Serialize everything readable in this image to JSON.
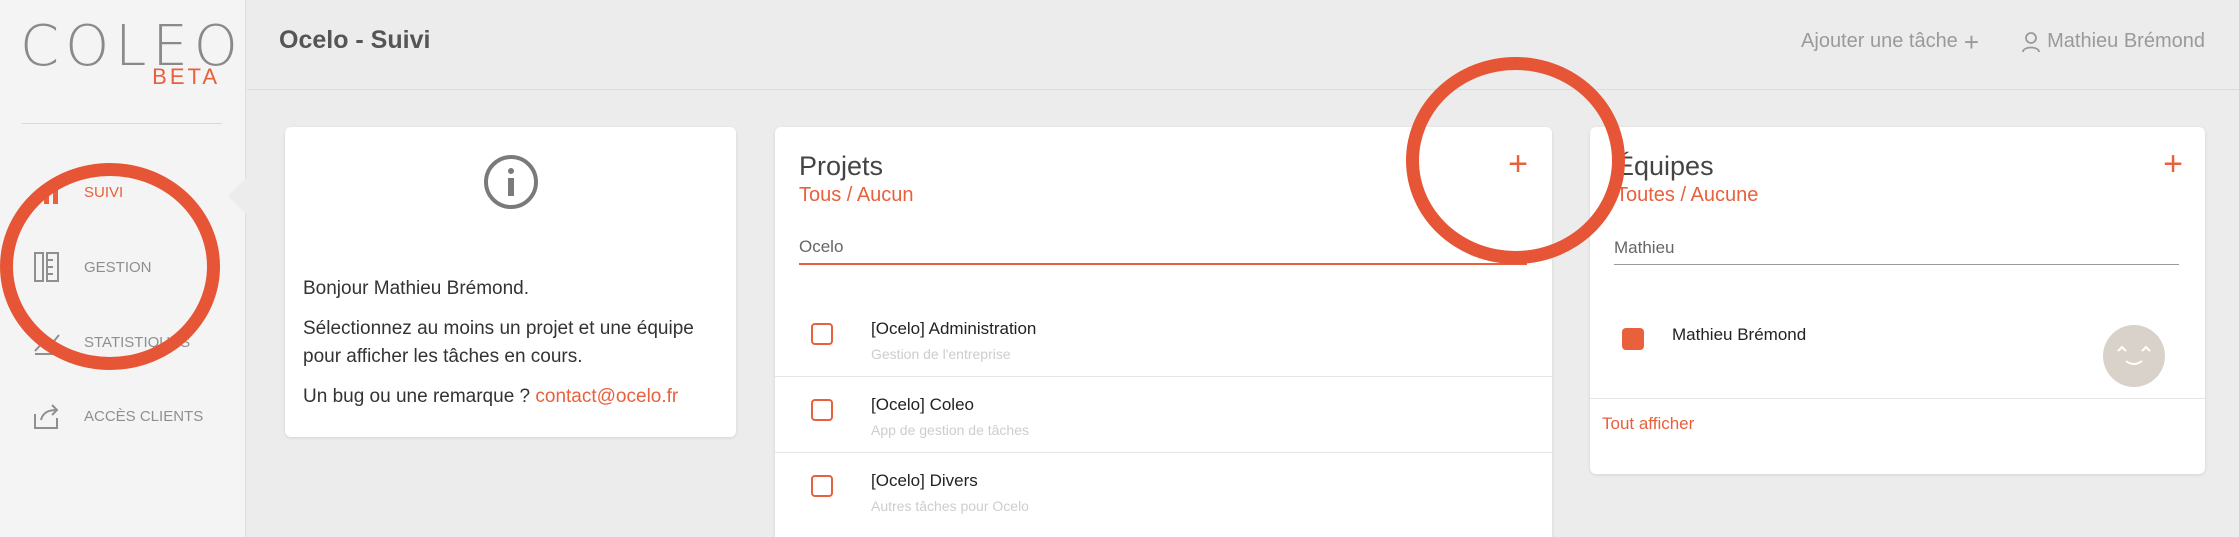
{
  "logo": {
    "text": "COLEO",
    "badge": "BETA"
  },
  "sidebar": {
    "items": [
      {
        "label": "SUIVI",
        "icon": "bar-chart-icon",
        "active": true
      },
      {
        "label": "GESTION",
        "icon": "ruler-pencil-icon",
        "active": false
      },
      {
        "label": "STATISTIQUES",
        "icon": "trend-up-icon",
        "active": false
      },
      {
        "label": "ACCÈS CLIENTS",
        "icon": "share-export-icon",
        "active": false
      }
    ]
  },
  "header": {
    "title": "Ocelo - Suivi",
    "add_task_label": "Ajouter une tâche",
    "add_task_icon": "plus-icon",
    "user_name": "Mathieu Brémond",
    "user_icon": "user-icon"
  },
  "info": {
    "icon": "info-circle-icon",
    "greeting": "Bonjour Mathieu Brémond.",
    "instruction": "Sélectionnez au moins un projet et une équipe pour afficher les tâches en cours.",
    "bug_text": "Un bug ou une remarque ?",
    "contact": "contact@ocelo.fr"
  },
  "projects": {
    "title": "Projets",
    "filter_links": "Tous / Aucun",
    "filter_value": "Ocelo",
    "add_icon": "plus-icon",
    "items": [
      {
        "name": "[Ocelo] Administration",
        "description": "Gestion de l'entreprise",
        "checked": false
      },
      {
        "name": "[Ocelo] Coleo",
        "description": "App de gestion de tâches",
        "checked": false
      },
      {
        "name": "[Ocelo] Divers",
        "description": "Autres tâches pour Ocelo",
        "checked": false
      }
    ]
  },
  "teams": {
    "title": "Équipes",
    "filter_links": "Toutes / Aucune",
    "filter_value": "Mathieu",
    "add_icon": "plus-icon",
    "items": [
      {
        "name": "Mathieu Brémond",
        "checked": true,
        "avatar": "avatar-face"
      }
    ],
    "show_all": "Tout afficher"
  },
  "colors": {
    "accent": "#e8603c",
    "annotation": "#e65535"
  }
}
